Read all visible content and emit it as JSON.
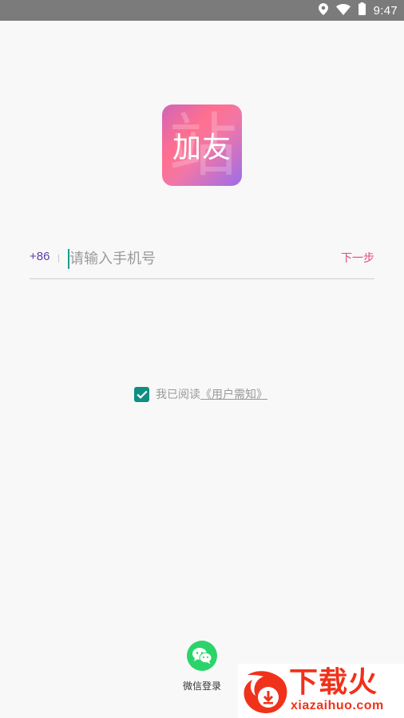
{
  "status_bar": {
    "time": "9:47",
    "icons": [
      "location-icon",
      "wifi-icon",
      "battery-icon"
    ]
  },
  "logo": {
    "text": "加友",
    "watermark_char": "站"
  },
  "phone_input": {
    "country_code": "+86",
    "placeholder": "请输入手机号",
    "value": "",
    "next_label": "下一步"
  },
  "agreement": {
    "checked": true,
    "text": "我已阅读",
    "link_text": "《用户需知》"
  },
  "wechat_login": {
    "label": "微信登录",
    "icon": "wechat-icon"
  },
  "site_watermark": {
    "title": "下载火",
    "url": "xiazaihuo.com"
  },
  "colors": {
    "accent_purple": "#5b3fa6",
    "next_pink": "#e34a72",
    "checkbox_teal": "#0f8f82",
    "wechat_green": "#2ad46a",
    "watermark_red": "#f0321a"
  }
}
